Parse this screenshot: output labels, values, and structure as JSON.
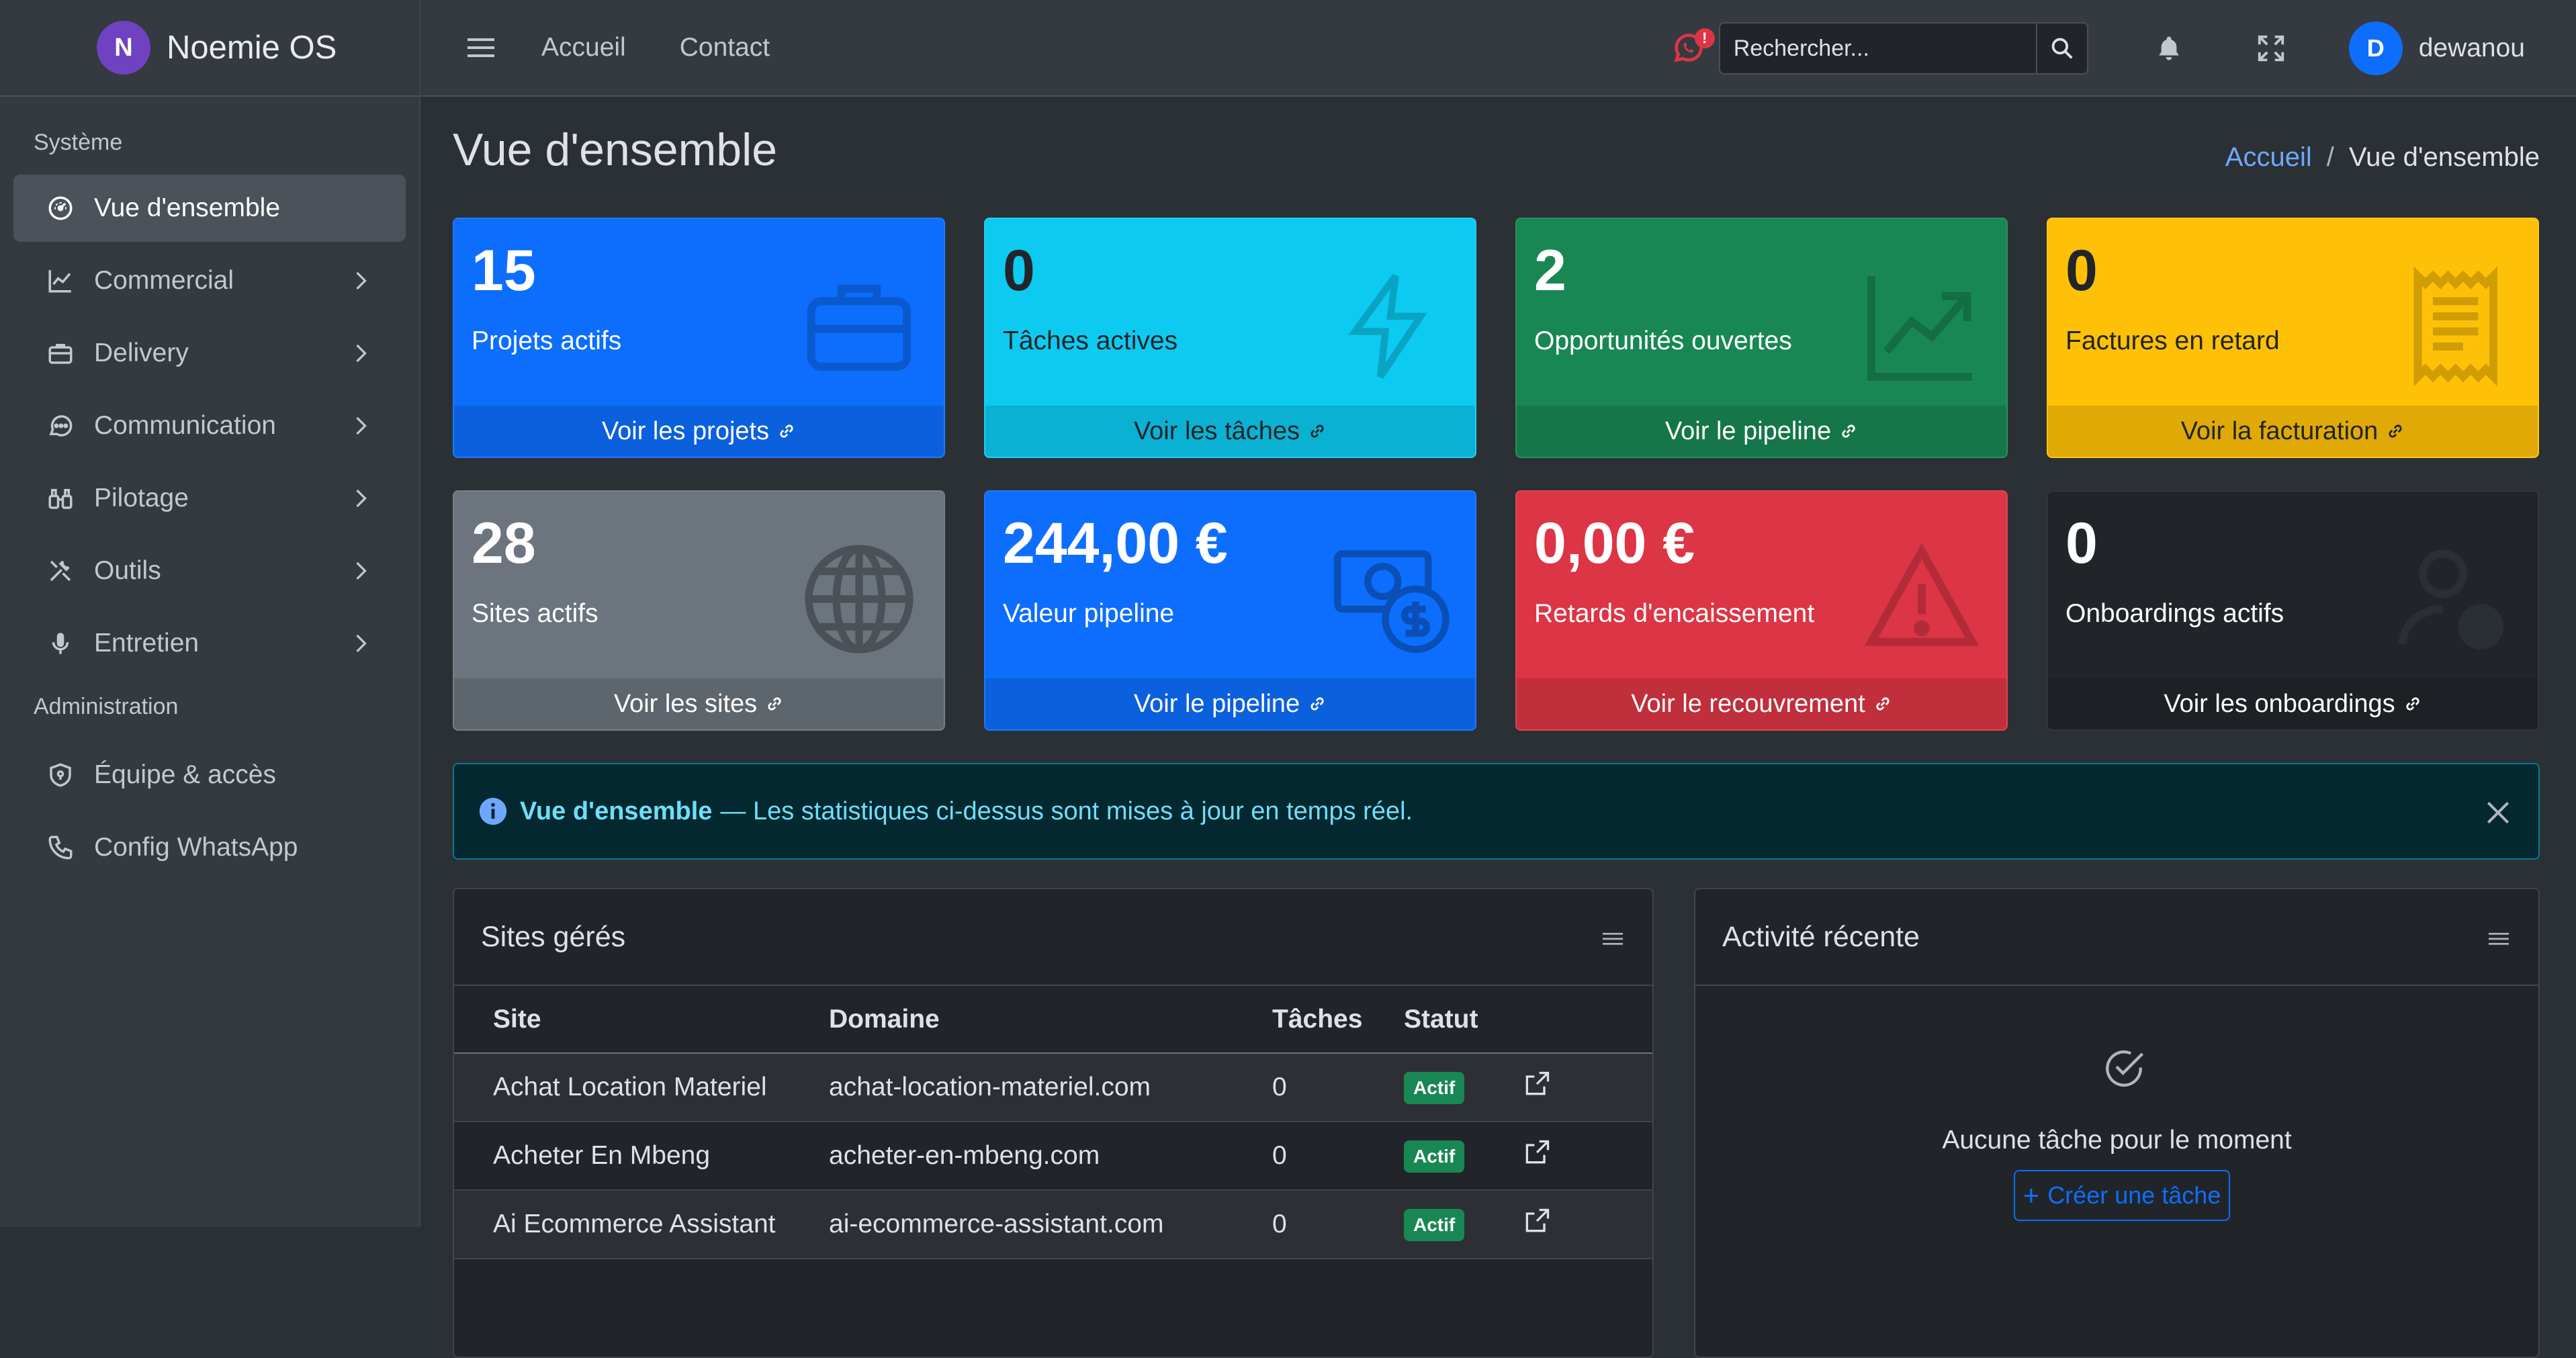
{
  "brand": {
    "logo_letter": "N",
    "name": "Noemie OS"
  },
  "sidebar": {
    "section_system": "Système",
    "items": [
      {
        "label": "Vue d'ensemble",
        "icon": "gauge-icon",
        "active": true
      },
      {
        "label": "Commercial",
        "icon": "chart-line-icon"
      },
      {
        "label": "Delivery",
        "icon": "briefcase-icon"
      },
      {
        "label": "Communication",
        "icon": "chat-dots-icon"
      },
      {
        "label": "Pilotage",
        "icon": "binoculars-icon"
      },
      {
        "label": "Outils",
        "icon": "tools-icon"
      },
      {
        "label": "Entretien",
        "icon": "mic-icon"
      }
    ],
    "section_admin": "Administration",
    "admin_items": [
      {
        "label": "Équipe & accès",
        "icon": "shield-lock-icon"
      },
      {
        "label": "Config WhatsApp",
        "icon": "phone-icon"
      }
    ]
  },
  "topbar": {
    "links": [
      "Accueil",
      "Contact"
    ],
    "whatsapp_badge": "!",
    "search_placeholder": "Rechercher...",
    "user_initial": "D",
    "user_name": "dewanou"
  },
  "page": {
    "title": "Vue d'ensemble",
    "breadcrumb": {
      "home": "Accueil",
      "separator": "/",
      "current": "Vue d'ensemble"
    }
  },
  "stats": [
    {
      "value": "15",
      "label": "Projets actifs",
      "link": "Voir les projets",
      "color": "#0d6efd",
      "icon": "briefcase-icon"
    },
    {
      "value": "0",
      "label": "Tâches actives",
      "link": "Voir les tâches",
      "color": "#0dcaf0",
      "icon": "lightning-icon"
    },
    {
      "value": "2",
      "label": "Opportunités ouvertes",
      "link": "Voir le pipeline",
      "color": "#198754",
      "icon": "graph-up-icon"
    },
    {
      "value": "0",
      "label": "Factures en retard",
      "link": "Voir la facturation",
      "color": "#ffc107",
      "icon": "receipt-icon"
    },
    {
      "value": "28",
      "label": "Sites actifs",
      "link": "Voir les sites",
      "color": "#6c757d",
      "icon": "globe-icon"
    },
    {
      "value": "244,00 €",
      "label": "Valeur pipeline",
      "link": "Voir le pipeline",
      "color": "#0d6efd",
      "icon": "cash-coin-icon"
    },
    {
      "value": "0,00 €",
      "label": "Retards d'encaissement",
      "link": "Voir le recouvrement",
      "color": "#dc3545",
      "icon": "warning-icon"
    },
    {
      "value": "0",
      "label": "Onboardings actifs",
      "link": "Voir les onboardings",
      "color": "#212529",
      "icon": "person-check-icon"
    }
  ],
  "alert": {
    "title": "Vue d'ensemble",
    "text": "— Les statistiques ci-dessus sont mises à jour en temps réel."
  },
  "sites_card": {
    "title": "Sites gérés",
    "columns": [
      "Site",
      "Domaine",
      "Tâches",
      "Statut"
    ],
    "rows": [
      {
        "site": "Achat Location Materiel",
        "domain": "achat-location-materiel.com",
        "tasks": "0",
        "status": "Actif"
      },
      {
        "site": "Acheter En Mbeng",
        "domain": "acheter-en-mbeng.com",
        "tasks": "0",
        "status": "Actif"
      },
      {
        "site": "Ai Ecommerce Assistant",
        "domain": "ai-ecommerce-assistant.com",
        "tasks": "0",
        "status": "Actif"
      }
    ]
  },
  "activity_card": {
    "title": "Activité récente",
    "empty_message": "Aucune tâche pour le moment",
    "create_label": "Créer une tâche"
  }
}
